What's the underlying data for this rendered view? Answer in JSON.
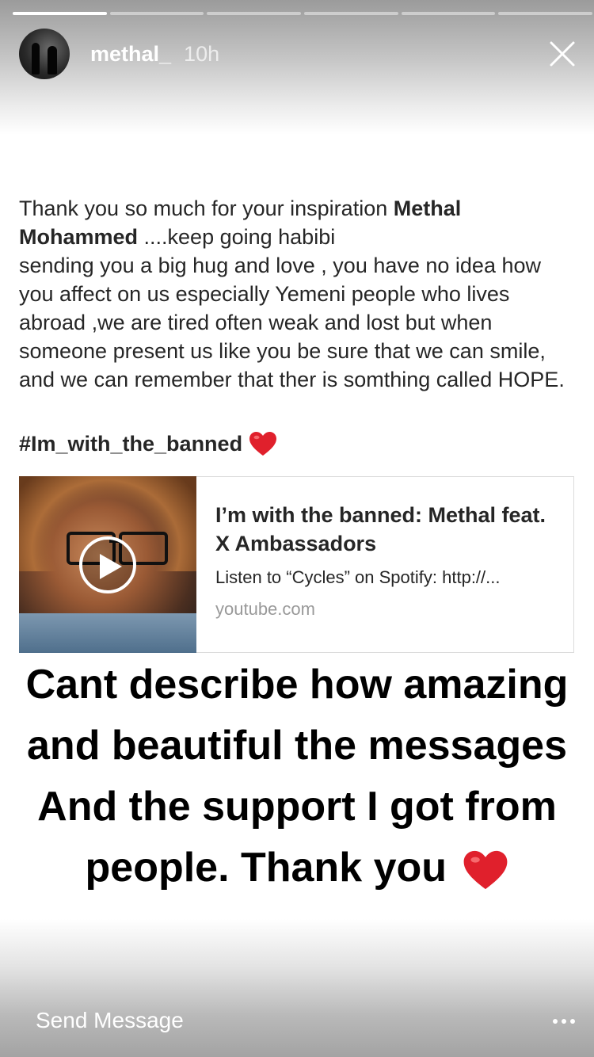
{
  "story": {
    "progress_segments": 6,
    "active_segment": 1,
    "username": "methal_",
    "time_ago": "10h",
    "close_icon": "close-icon"
  },
  "post": {
    "line1_prefix": "Thank you so much for your inspiration ",
    "mention": "Methal Mohammed",
    "line1_suffix": " ....keep going habibi",
    "body": "sending you a big hug and love , you have no idea how you affect on us especially Yemeni people who lives abroad ,we are tired often weak and lost but when someone present us like you be sure that we can smile, and we can remember that ther is somthing called HOPE.",
    "hashtag": "#Im_with_the_banned"
  },
  "link_card": {
    "title": "I’m with the banned: Methal feat. X Ambassadors",
    "description": "Listen to “Cycles” on Spotify: http://...",
    "domain": "youtube.com",
    "play_icon": "play-icon"
  },
  "sticker": {
    "text": "Cant describe how amazing and beautiful the messages And the support I got from people. Thank you"
  },
  "footer": {
    "send_message": "Send Message",
    "more_icon": "more-horizontal-icon"
  },
  "colors": {
    "heart": "#e0202c",
    "muted": "#999999"
  }
}
